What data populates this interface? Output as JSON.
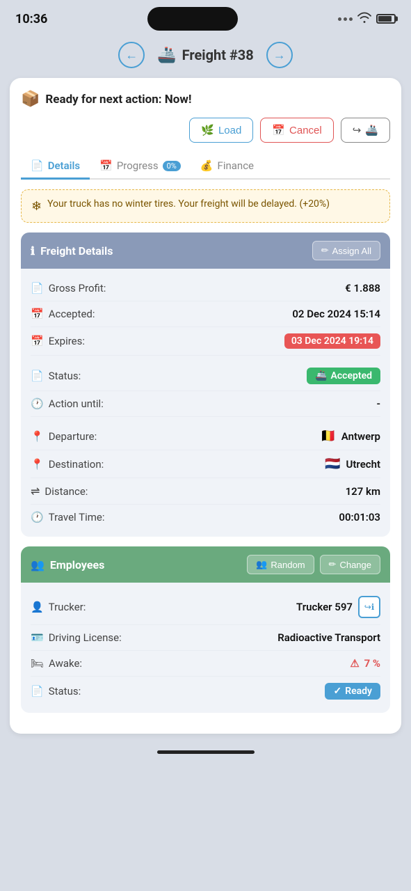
{
  "statusBar": {
    "time": "10:36",
    "batteryPercent": 85
  },
  "nav": {
    "title": "Freight #38",
    "prevLabel": "←",
    "nextLabel": "→"
  },
  "readyBanner": {
    "text": "Ready for next action: Now!"
  },
  "actionButtons": {
    "load": "Load",
    "cancel": "Cancel",
    "transfer": "Transfer"
  },
  "tabs": [
    {
      "id": "details",
      "label": "Details",
      "active": true,
      "badge": null
    },
    {
      "id": "progress",
      "label": "Progress",
      "active": false,
      "badge": "0%"
    },
    {
      "id": "finance",
      "label": "Finance",
      "active": false,
      "badge": null
    }
  ],
  "warning": {
    "text": "Your truck has no winter tires. Your freight will be delayed. (+20%)"
  },
  "freightDetails": {
    "sectionTitle": "Freight Details",
    "assignAllLabel": "Assign All",
    "rows": [
      {
        "label": "Gross Profit:",
        "value": "€ 1.888",
        "type": "normal"
      },
      {
        "label": "Accepted:",
        "value": "02 Dec 2024 15:14",
        "type": "normal"
      },
      {
        "label": "Expires:",
        "value": "03 Dec 2024 19:14",
        "type": "expires"
      },
      {
        "label": "Status:",
        "value": "Accepted",
        "type": "accepted-badge"
      },
      {
        "label": "Action until:",
        "value": "-",
        "type": "normal"
      },
      {
        "label": "Departure:",
        "value": "Antwerp",
        "flag": "🇧🇪",
        "type": "flag"
      },
      {
        "label": "Destination:",
        "value": "Utrecht",
        "flag": "🇳🇱",
        "type": "flag"
      },
      {
        "label": "Distance:",
        "value": "127 km",
        "type": "normal"
      },
      {
        "label": "Travel Time:",
        "value": "00:01:03",
        "type": "normal"
      }
    ]
  },
  "employees": {
    "sectionTitle": "Employees",
    "randomLabel": "Random",
    "changeLabel": "Change",
    "rows": [
      {
        "label": "Trucker:",
        "value": "Trucker 597",
        "type": "trucker"
      },
      {
        "label": "Driving License:",
        "value": "Radioactive Transport",
        "type": "normal"
      },
      {
        "label": "Awake:",
        "value": "⚠ 7 %",
        "type": "warning"
      },
      {
        "label": "Status:",
        "value": "Ready",
        "type": "ready-badge"
      }
    ]
  },
  "icons": {
    "back": "←",
    "forward": "→",
    "freightIcon": "🚢",
    "readyIcon": "📦",
    "loadIcon": "🌿",
    "cancelIcon": "📅",
    "transferIcon": "↪",
    "detailsIcon": "📄",
    "progressIcon": "📅",
    "financeIcon": "💰",
    "warningSnow": "❄",
    "infoIcon": "ℹ",
    "assignIcon": "✏",
    "pinIcon": "📍",
    "clockIcon": "🕐",
    "docIcon": "📄",
    "calIcon": "📅",
    "distIcon": "⇌",
    "usersIcon": "👥",
    "randomIcon": "🎲",
    "changeIcon": "✏",
    "truckerIcon": "👤",
    "licenseIcon": "🪪",
    "bedIcon": "🛏",
    "statusDocIcon": "📄",
    "checkIcon": "✓"
  }
}
